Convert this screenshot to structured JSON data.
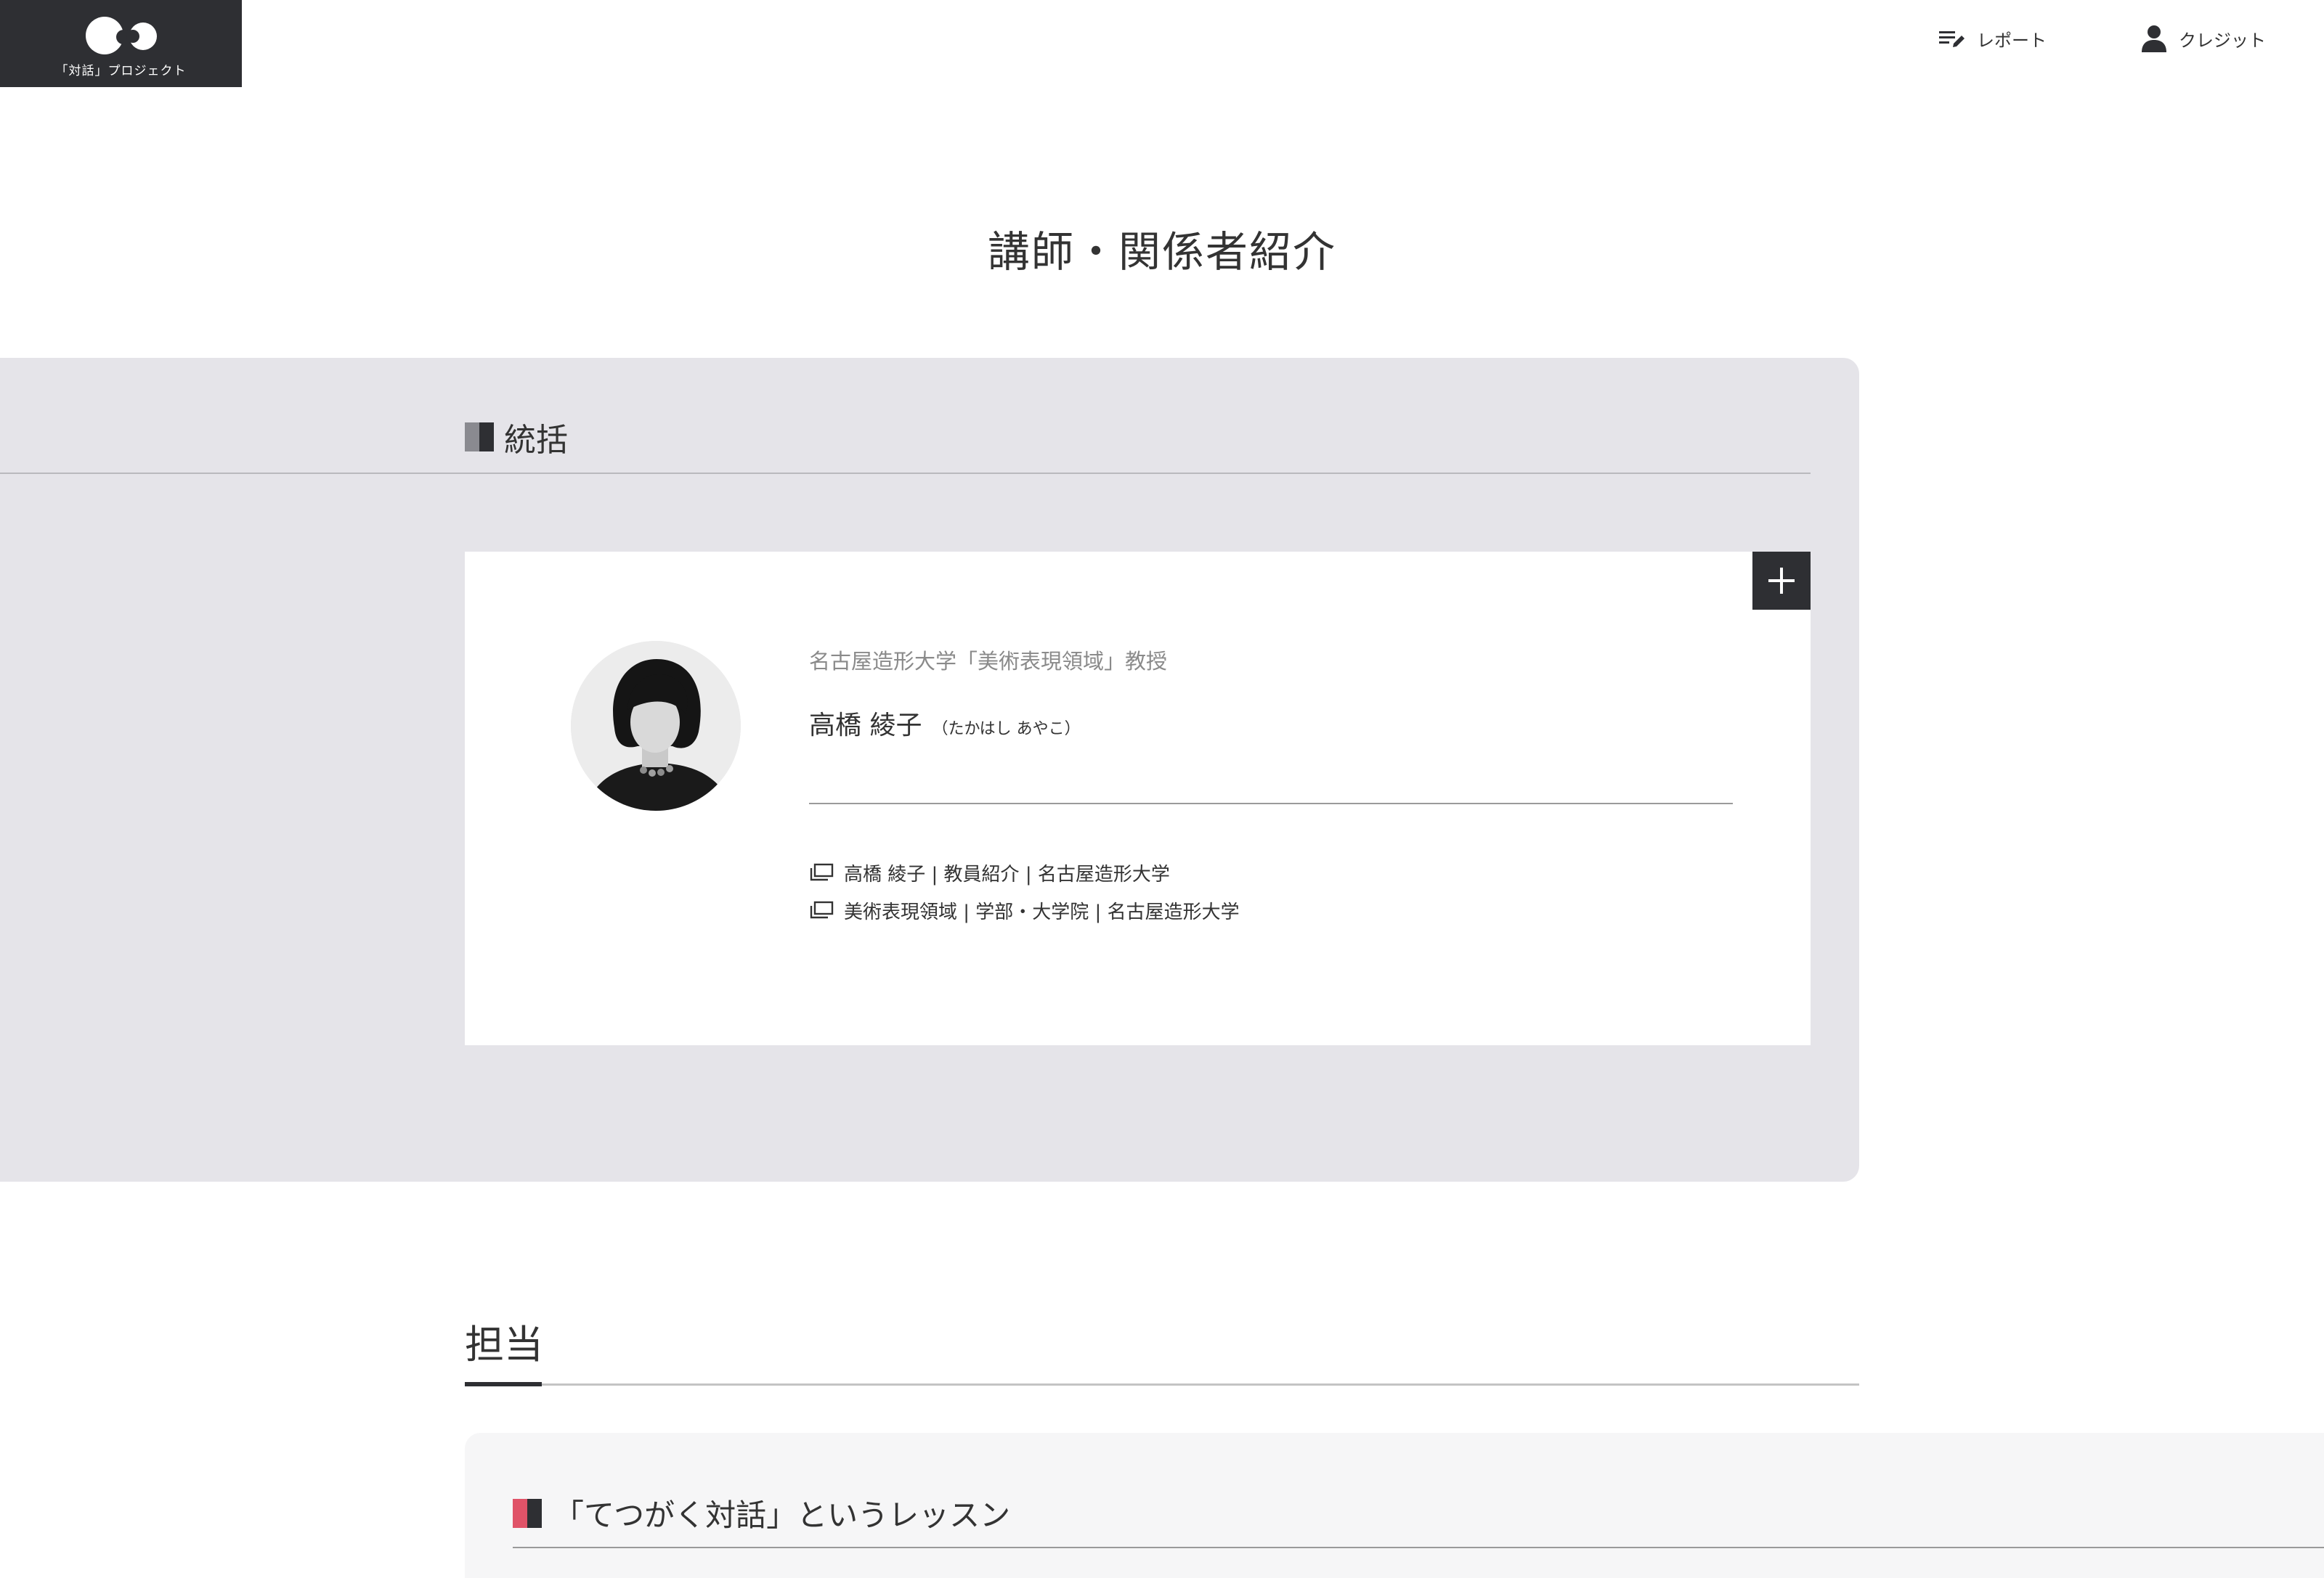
{
  "header": {
    "logo_text": "「対話」プロジェクト",
    "nav": [
      {
        "label": "レポート",
        "icon": "report-edit-icon"
      },
      {
        "label": "クレジット",
        "icon": "person-icon"
      }
    ]
  },
  "page": {
    "title": "講師・関係者紹介"
  },
  "supervision": {
    "label": "統括",
    "person": {
      "role": "名古屋造形大学「美術表現領域」教授",
      "name": "高橋 綾子",
      "kana": "（たかはし あやこ）",
      "links": [
        {
          "text": "高橋 綾子 | 教員紹介 | 名古屋造形大学",
          "icon": "external-link-icon"
        },
        {
          "text": "美術表現領域 | 学部・大学院 | 名古屋造形大学",
          "icon": "external-link-icon"
        }
      ]
    }
  },
  "tanto": {
    "title": "担当",
    "lesson_title": "「てつがく対話」というレッスン"
  },
  "colors": {
    "dark": "#2e2f33",
    "section_bg": "#e5e4e9",
    "accent_red": "#e05368"
  }
}
